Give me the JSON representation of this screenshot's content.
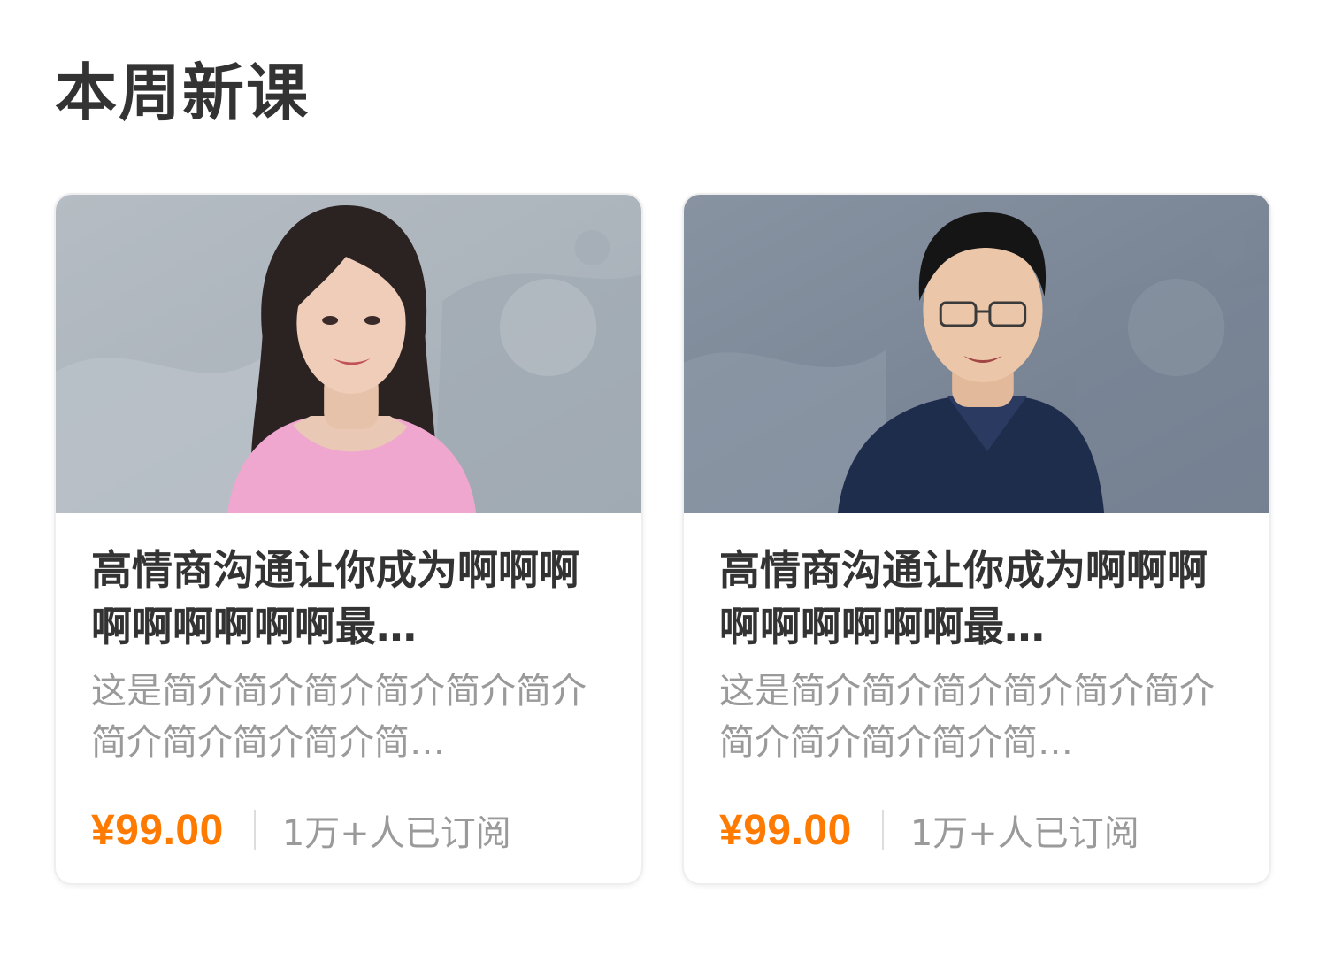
{
  "section": {
    "title": "本周新课"
  },
  "courses": [
    {
      "title": "高情商沟通让你成为啊啊啊啊啊啊啊啊啊最…",
      "description": "这是简介简介简介简介简介简介简介简介简介简介简…",
      "price": "¥99.00",
      "subscribers": "1万+人已订阅",
      "cover_icon": "teacher-photo-female"
    },
    {
      "title": "高情商沟通让你成为啊啊啊啊啊啊啊啊啊最…",
      "description": "这是简介简介简介简介简介简介简介简介简介简介简…",
      "price": "¥99.00",
      "subscribers": "1万+人已订阅",
      "cover_icon": "teacher-photo-male"
    }
  ],
  "colors": {
    "price": "#ff7a00",
    "title": "#333333",
    "muted": "#9a9a9a",
    "cover_bg_1": "#a9b1b9",
    "cover_bg_2": "#7b8797"
  }
}
